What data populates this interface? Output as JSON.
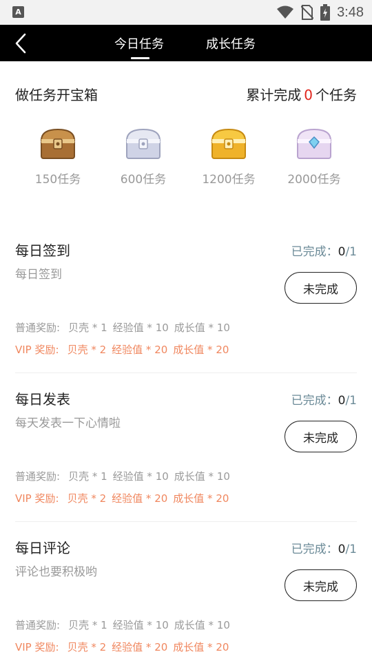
{
  "status_bar": {
    "app_icon_letter": "A",
    "time": "3:48"
  },
  "nav": {
    "tabs": [
      {
        "label": "今日任务",
        "active": true
      },
      {
        "label": "成长任务",
        "active": false
      }
    ]
  },
  "treasure": {
    "title": "做任务开宝箱",
    "total_prefix": "累计完成",
    "total_count": "0",
    "total_suffix": "个任务",
    "chests": [
      {
        "label": "150任务",
        "icon": "bronze-chest-icon",
        "color": "#b07a3b"
      },
      {
        "label": "600任务",
        "icon": "silver-chest-icon",
        "color": "#c9cde0"
      },
      {
        "label": "1200任务",
        "icon": "gold-chest-icon",
        "color": "#f0b52a"
      },
      {
        "label": "2000任务",
        "icon": "diamond-chest-icon",
        "color": "#e8d8f0"
      }
    ]
  },
  "tasks": [
    {
      "title": "每日签到",
      "desc": "每日签到",
      "progress_label": "已完成：",
      "progress_current": "0",
      "progress_total": "/1",
      "button": "未完成",
      "normal_label": "普通奖励:",
      "normal_rewards": [
        "贝壳 * 1",
        "经验值 * 10",
        "成长值 * 10"
      ],
      "vip_label": "VIP 奖励:",
      "vip_rewards": [
        "贝壳 * 2",
        "经验值 * 20",
        "成长值 * 20"
      ]
    },
    {
      "title": "每日发表",
      "desc": "每天发表一下心情啦",
      "progress_label": "已完成：",
      "progress_current": "0",
      "progress_total": "/1",
      "button": "未完成",
      "normal_label": "普通奖励:",
      "normal_rewards": [
        "贝壳 * 1",
        "经验值 * 10",
        "成长值 * 10"
      ],
      "vip_label": "VIP 奖励:",
      "vip_rewards": [
        "贝壳 * 2",
        "经验值 * 20",
        "成长值 * 20"
      ]
    },
    {
      "title": "每日评论",
      "desc": "评论也要积极哟",
      "progress_label": "已完成：",
      "progress_current": "0",
      "progress_total": "/1",
      "button": "未完成",
      "normal_label": "普通奖励:",
      "normal_rewards": [
        "贝壳 * 1",
        "经验值 * 10",
        "成长值 * 10"
      ],
      "vip_label": "VIP 奖励:",
      "vip_rewards": [
        "贝壳 * 2",
        "经验值 * 20",
        "成长值 * 20"
      ]
    }
  ],
  "colors": {
    "accent_red": "#e0241b",
    "vip_orange": "#f0875f",
    "progress_gray_blue": "#6b8a97",
    "navbar": "#000000"
  }
}
